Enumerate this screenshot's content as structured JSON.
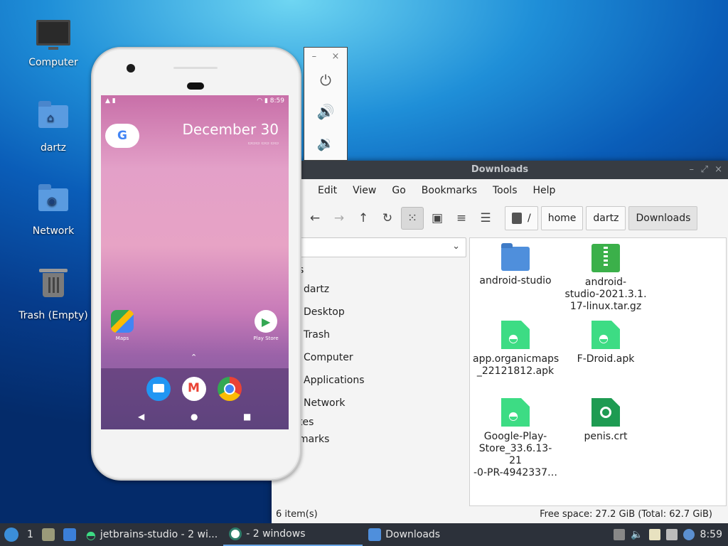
{
  "desktop": {
    "icons": [
      {
        "label": "Computer"
      },
      {
        "label": "dartz"
      },
      {
        "label": "Network"
      },
      {
        "label": "Trash (Empty)"
      }
    ]
  },
  "phone": {
    "status_time": "8:59",
    "date": "December 30",
    "apps": {
      "maps": "Maps",
      "play_store": "Play Store"
    },
    "google_letter": "G"
  },
  "emulator_panel": {
    "minimize": "–",
    "close": "×"
  },
  "file_manager": {
    "title": "Downloads",
    "menu": [
      "Edit",
      "View",
      "Go",
      "Bookmarks",
      "Tools",
      "Help"
    ],
    "breadcrumbs": [
      "/",
      "home",
      "dartz",
      "Downloads"
    ],
    "sidebar": {
      "head_places": "s",
      "items": [
        "dartz",
        "Desktop",
        "Trash",
        "Computer",
        "Applications",
        "Network"
      ],
      "head_devices": "tes",
      "head_bookmarks": "marks"
    },
    "files": [
      {
        "name": "android-studio",
        "type": "folder"
      },
      {
        "name": "android-studio-2021.3.1.17-linux.tar.gz",
        "line1": "android-",
        "line2": "studio-2021.3.1.",
        "line3": "17-linux.tar.gz",
        "type": "archive"
      },
      {
        "name": "app.organicmaps_22121812.apk",
        "line1": "app.organicmaps",
        "line2": "_22121812.apk",
        "type": "apk"
      },
      {
        "name": "F-Droid.apk",
        "type": "apk"
      },
      {
        "name": "Google-Play-Store_33.6.13-21-0-PR-4942337…",
        "line1": "Google-Play-",
        "line2": "Store_33.6.13-21",
        "line3": "-0-PR-4942337…",
        "type": "apk"
      },
      {
        "name": "penis.crt",
        "type": "crt"
      }
    ],
    "status_left": "6 item(s)",
    "status_right": "Free space: 27.2 GiB (Total: 62.7 GiB)"
  },
  "taskbar": {
    "workspace": "1",
    "tasks": [
      {
        "label": "jetbrains-studio - 2 wi..."
      },
      {
        "label": "- 2 windows"
      },
      {
        "label": "Downloads"
      }
    ],
    "clock": "8:59"
  },
  "colors": {
    "taskbar_bg": "#2c313a",
    "titlebar_bg": "#373c43",
    "accent": "#6aa7e8"
  }
}
